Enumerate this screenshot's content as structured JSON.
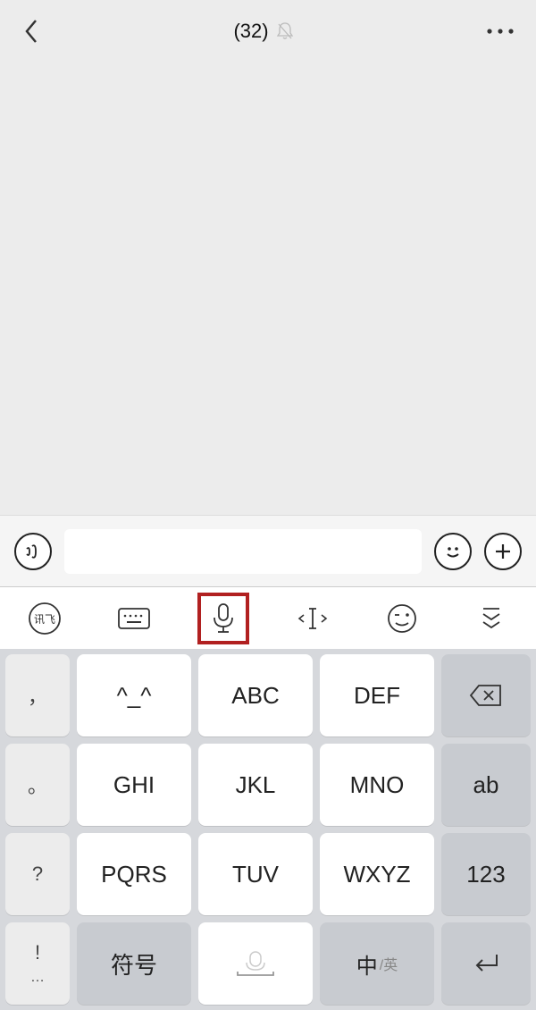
{
  "header": {
    "title": "(32)"
  },
  "keypad": {
    "side": {
      "comma": "，",
      "dot": "。",
      "question": "?",
      "exclaim": "!",
      "ellipsis": "…"
    },
    "keys": {
      "r1c1": "^_^",
      "r1c2": "ABC",
      "r1c3": "DEF",
      "r2c1": "GHI",
      "r2c2": "JKL",
      "r2c3": "MNO",
      "r3c1": "PQRS",
      "r3c2": "TUV",
      "r3c3": "WXYZ",
      "r4c1": "符号",
      "r4c3_main": "中",
      "r4c3_sub": "/英"
    },
    "func": {
      "ab": "ab",
      "num": "123"
    }
  },
  "toolbar": {
    "ime_label": "讯飞"
  }
}
